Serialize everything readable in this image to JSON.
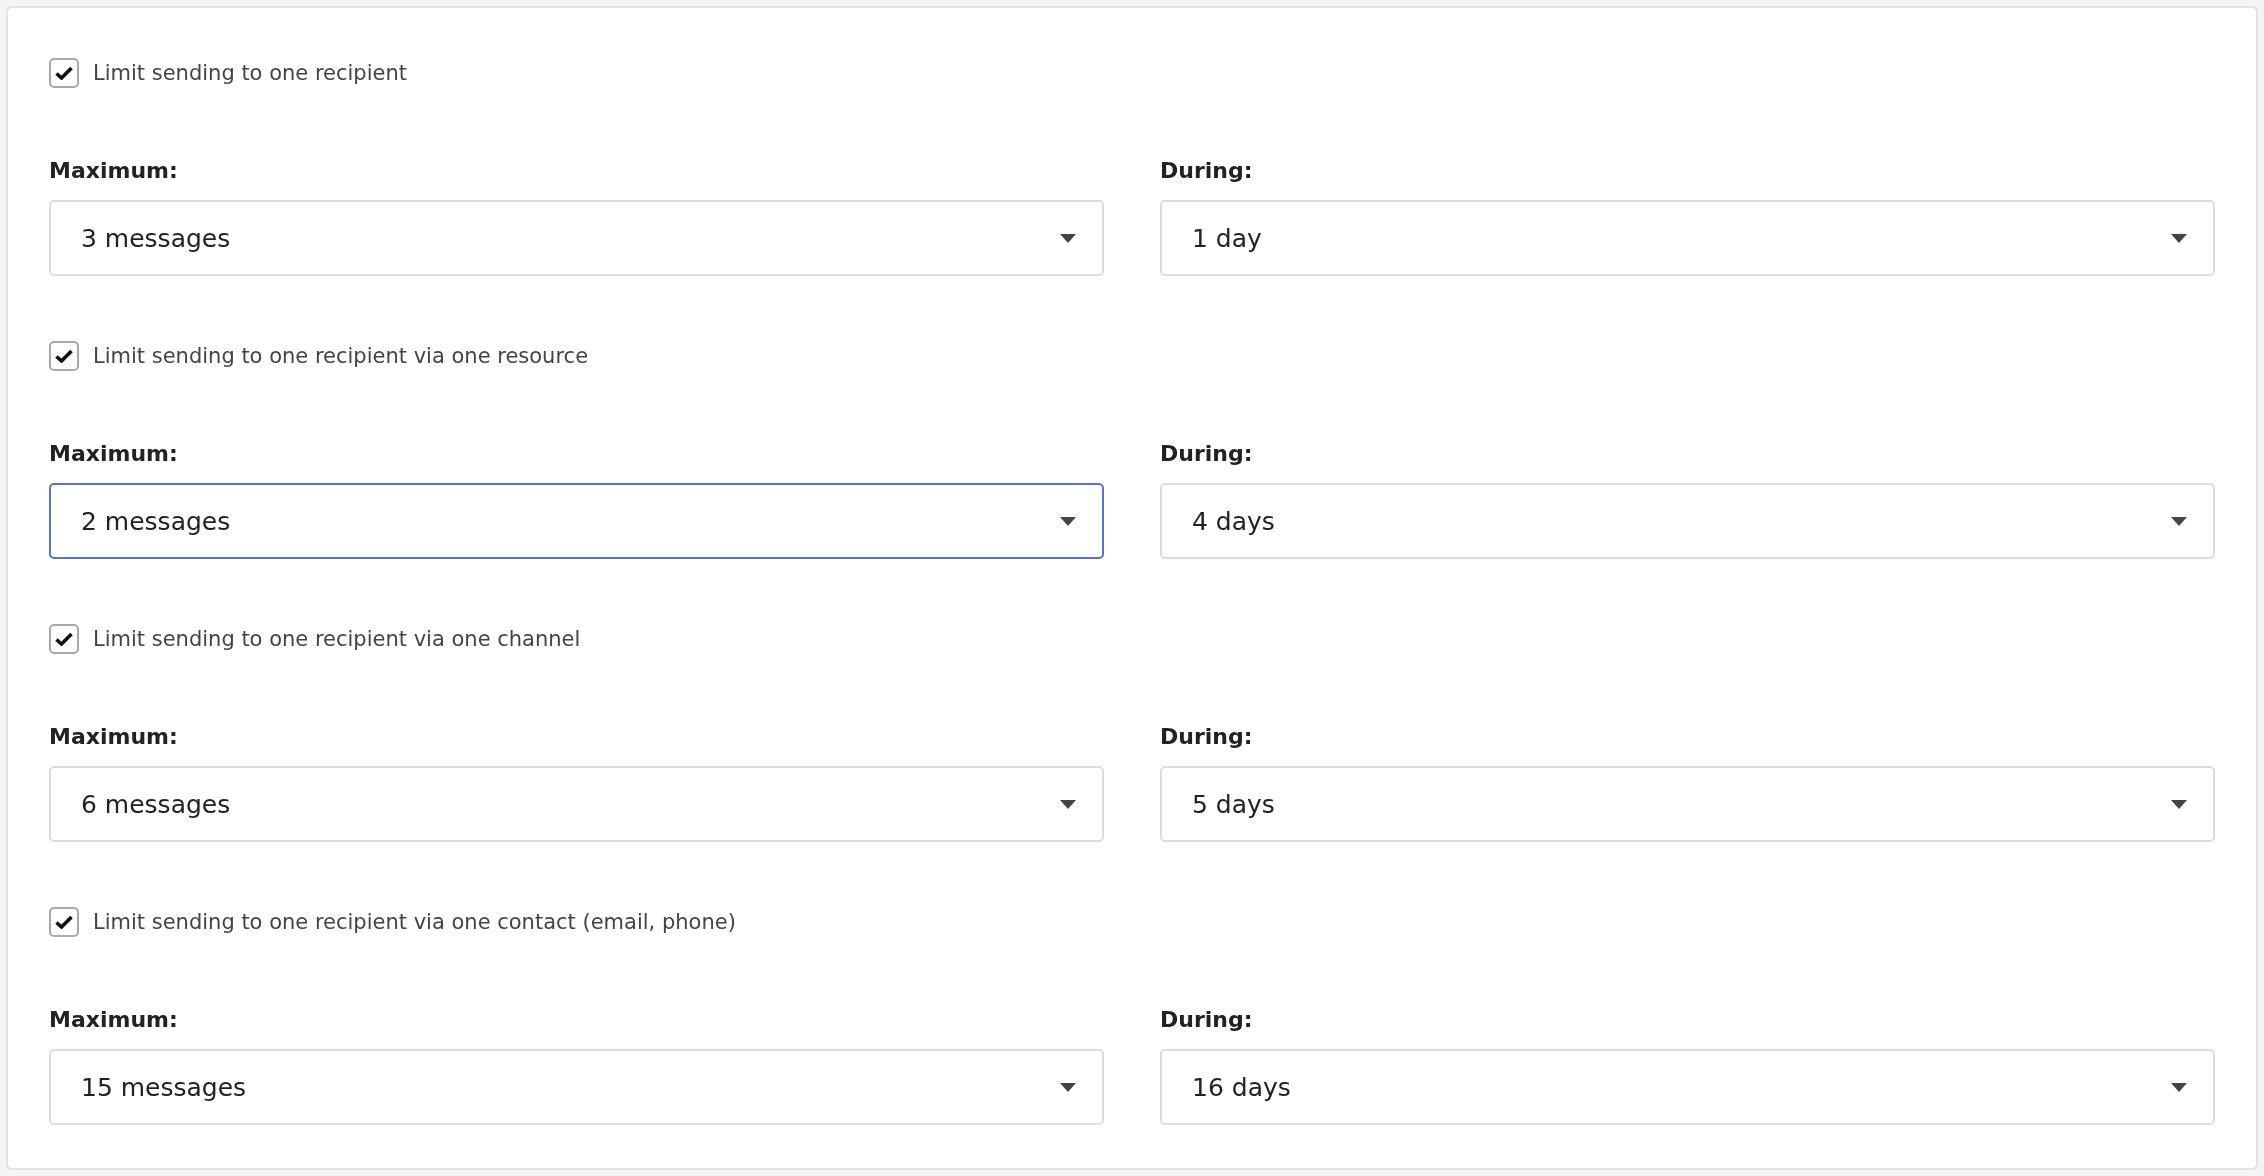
{
  "limits": [
    {
      "label": "Limit sending to one recipient",
      "checked": true,
      "maximum": {
        "label": "Maximum:",
        "value": "3 messages",
        "focused": false
      },
      "during": {
        "label": "During:",
        "value": "1 day",
        "focused": false
      }
    },
    {
      "label": "Limit sending to one recipient via one resource",
      "checked": true,
      "maximum": {
        "label": "Maximum:",
        "value": "2 messages",
        "focused": true
      },
      "during": {
        "label": "During:",
        "value": "4 days",
        "focused": false
      }
    },
    {
      "label": "Limit sending to one recipient via one channel",
      "checked": true,
      "maximum": {
        "label": "Maximum:",
        "value": "6 messages",
        "focused": false
      },
      "during": {
        "label": "During:",
        "value": "5 days",
        "focused": false
      }
    },
    {
      "label": "Limit sending to one recipient via one contact (email, phone)",
      "checked": true,
      "maximum": {
        "label": "Maximum:",
        "value": "15 messages",
        "focused": false
      },
      "during": {
        "label": "During:",
        "value": "16 days",
        "focused": false
      }
    }
  ]
}
